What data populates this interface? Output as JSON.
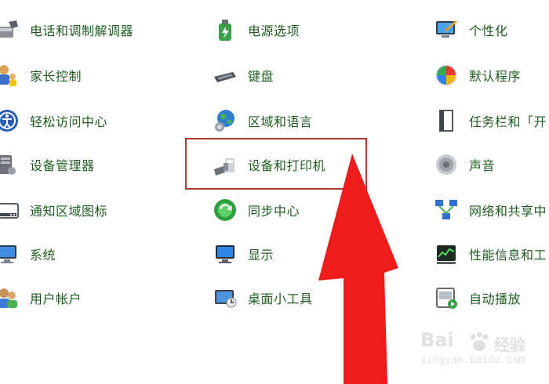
{
  "control_panel": {
    "col1": [
      {
        "label": "电话和调制解调器",
        "icon": "modem-icon"
      },
      {
        "label": "家长控制",
        "icon": "parental-controls-icon"
      },
      {
        "label": "轻松访问中心",
        "icon": "ease-of-access-icon"
      },
      {
        "label": "设备管理器",
        "icon": "device-manager-icon"
      },
      {
        "label": "通知区域图标",
        "icon": "notification-area-icon"
      },
      {
        "label": "系统",
        "icon": "system-icon"
      },
      {
        "label": "用户帐户",
        "icon": "user-accounts-icon"
      }
    ],
    "col2": [
      {
        "label": "电源选项",
        "icon": "power-options-icon"
      },
      {
        "label": "键盘",
        "icon": "keyboard-icon"
      },
      {
        "label": "区域和语言",
        "icon": "region-language-icon"
      },
      {
        "label": "设备和打印机",
        "icon": "devices-printers-icon"
      },
      {
        "label": "同步中心",
        "icon": "sync-center-icon"
      },
      {
        "label": "显示",
        "icon": "display-icon"
      },
      {
        "label": "桌面小工具",
        "icon": "desktop-gadgets-icon"
      }
    ],
    "col3": [
      {
        "label": "个性化",
        "icon": "personalization-icon"
      },
      {
        "label": "默认程序",
        "icon": "default-programs-icon"
      },
      {
        "label": "任务栏和「开",
        "icon": "taskbar-icon"
      },
      {
        "label": "声音",
        "icon": "sound-icon"
      },
      {
        "label": "网络和共享中",
        "icon": "network-sharing-icon"
      },
      {
        "label": "性能信息和工",
        "icon": "performance-icon"
      },
      {
        "label": "自动播放",
        "icon": "autoplay-icon"
      }
    ]
  },
  "annotation": {
    "color": "#ee1c1c",
    "highlight_color": "#b23a35"
  },
  "watermark": {
    "brand": "Bai",
    "suffix": "经验",
    "url": "jingyan.baidu.com"
  }
}
